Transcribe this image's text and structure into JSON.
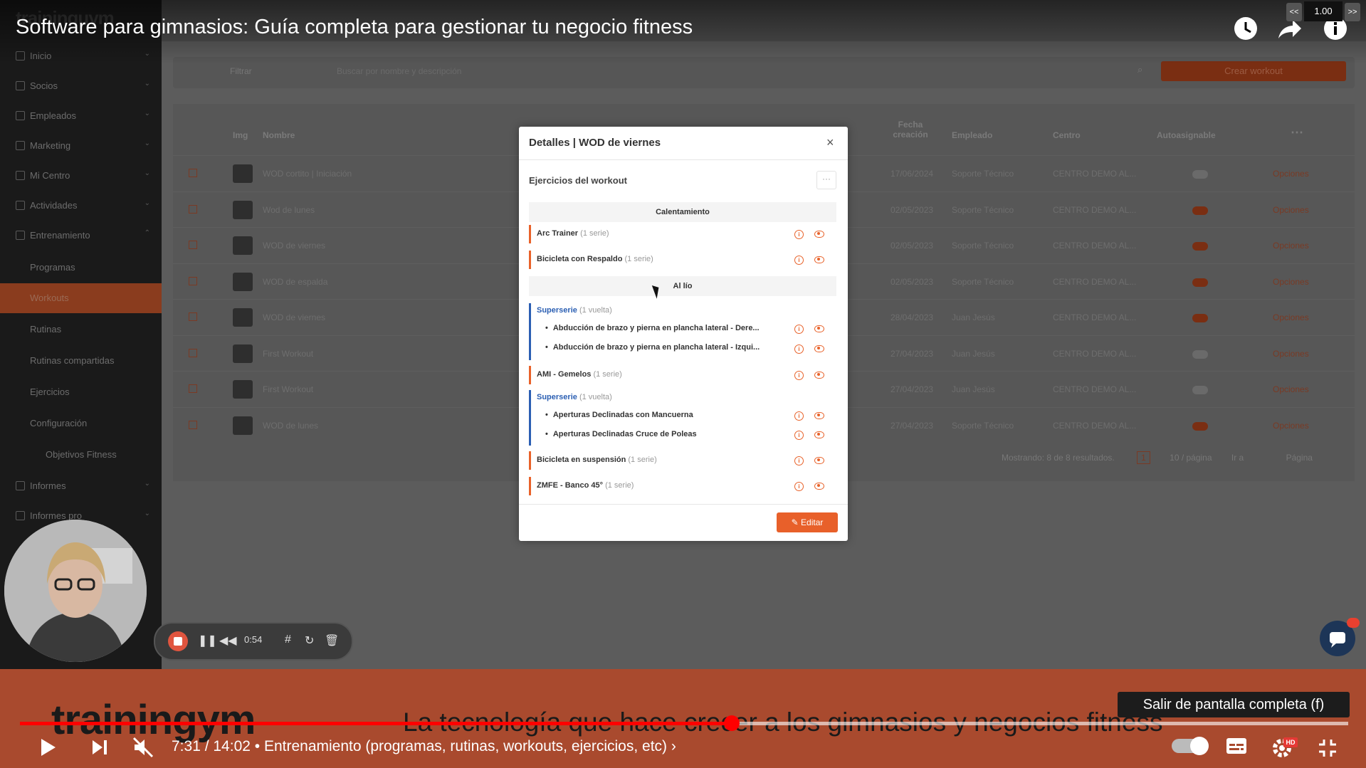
{
  "app": {
    "logo": "traininguym",
    "nav": [
      {
        "label": "Inicio"
      },
      {
        "label": "Socios"
      },
      {
        "label": "Empleados"
      },
      {
        "label": "Marketing"
      },
      {
        "label": "Mi Centro"
      },
      {
        "label": "Actividades"
      },
      {
        "label": "Entrenamiento"
      }
    ],
    "subnav": [
      {
        "label": "Programas"
      },
      {
        "label": "Workouts"
      },
      {
        "label": "Rutinas"
      },
      {
        "label": "Rutinas compartidas"
      },
      {
        "label": "Ejercicios"
      },
      {
        "label": "Configuración"
      },
      {
        "label": "Objetivos Fitness"
      }
    ],
    "nav_bottom": [
      {
        "label": "Informes"
      },
      {
        "label": "Informes pro"
      }
    ],
    "filter_label": "Filtrar",
    "search_placeholder": "Buscar por nombre y descripción",
    "create_button": "Crear workout",
    "table": {
      "headers": [
        "Img",
        "Nombre",
        "Fecha creación",
        "Empleado",
        "Centro",
        "Autoasignable"
      ],
      "rows": [
        {
          "nombre": "WOD cortito | Iniciación",
          "fecha": "17/06/2024",
          "empleado": "Soporte Técnico",
          "centro": "CENTRO DEMO AL...",
          "auto": false,
          "opciones": "Opciones"
        },
        {
          "nombre": "Wod de lunes",
          "fecha": "02/05/2023",
          "empleado": "Soporte Técnico",
          "centro": "CENTRO DEMO AL...",
          "auto": true,
          "opciones": "Opciones"
        },
        {
          "nombre": "WOD de viernes",
          "fecha": "02/05/2023",
          "empleado": "Soporte Técnico",
          "centro": "CENTRO DEMO AL...",
          "auto": true,
          "opciones": "Opciones"
        },
        {
          "nombre": "WOD de espalda",
          "fecha": "02/05/2023",
          "empleado": "Soporte Técnico",
          "centro": "CENTRO DEMO AL...",
          "auto": true,
          "opciones": "Opciones"
        },
        {
          "nombre": "WOD de viernes",
          "fecha": "28/04/2023",
          "empleado": "Juan Jesús",
          "centro": "CENTRO DEMO AL...",
          "auto": true,
          "opciones": "Opciones"
        },
        {
          "nombre": "First Workout",
          "fecha": "27/04/2023",
          "empleado": "Juan Jesús",
          "centro": "CENTRO DEMO AL...",
          "auto": false,
          "opciones": "Opciones"
        },
        {
          "nombre": "First Workout",
          "fecha": "27/04/2023",
          "empleado": "Juan Jesús",
          "centro": "CENTRO DEMO AL...",
          "auto": false,
          "opciones": "Opciones"
        },
        {
          "nombre": "WOD de lunes",
          "fecha": "27/04/2023",
          "empleado": "Soporte Técnico",
          "centro": "CENTRO DEMO AL...",
          "auto": true,
          "opciones": "Opciones"
        }
      ]
    },
    "pagination": {
      "showing": "Mostrando: 8 de 8 resultados.",
      "page": "1",
      "per_page": "10 / página",
      "goto": "Ir a",
      "page_label": "Página"
    }
  },
  "modal": {
    "title": "Detalles | WOD de viernes",
    "close": "×",
    "section": "Ejercicios del workout",
    "more": "···",
    "group1": "Calentamiento",
    "group2": "Al lío",
    "ex": [
      {
        "name": "Arc Trainer",
        "series": "(1 serie)"
      },
      {
        "name": "Bicicleta con Respaldo",
        "series": "(1 serie)"
      },
      {
        "name": "Superserie",
        "series": "(1 vuelta)",
        "items": [
          "Abducción de brazo y pierna en plancha lateral - Dere...",
          "Abducción de brazo y pierna en plancha lateral - Izqui..."
        ]
      },
      {
        "name": "AMI - Gemelos",
        "series": "(1 serie)"
      },
      {
        "name": "Superserie",
        "series": "(1 vuelta)",
        "items": [
          "Aperturas Declinadas con Mancuerna",
          "Aperturas Declinadas Cruce de Poleas"
        ]
      },
      {
        "name": "Bicicleta en suspensión",
        "series": "(1 serie)"
      },
      {
        "name": "ZMFE - Banco 45°",
        "series": "(1 serie)"
      }
    ],
    "edit_label": "Editar"
  },
  "video": {
    "title": "Software para gimnasios: Guía completa para gestionar tu negocio fitness",
    "speed": "1.00",
    "speed_down": "<<",
    "speed_up": ">>",
    "rec_time": "0:54",
    "brand_overlay": "trainingym",
    "tagline": "La tecnología que hace crecer a los gimnasios y negocios fitness",
    "tooltip": "Salir de pantalla completa (f)",
    "time": "7:31 / 14:02",
    "chapter": "• Entrenamiento (programas, rutinas, workouts, ejercicios, etc)",
    "chapter_arrow": "›",
    "progress": 0.536,
    "hd_badge": "HD"
  }
}
